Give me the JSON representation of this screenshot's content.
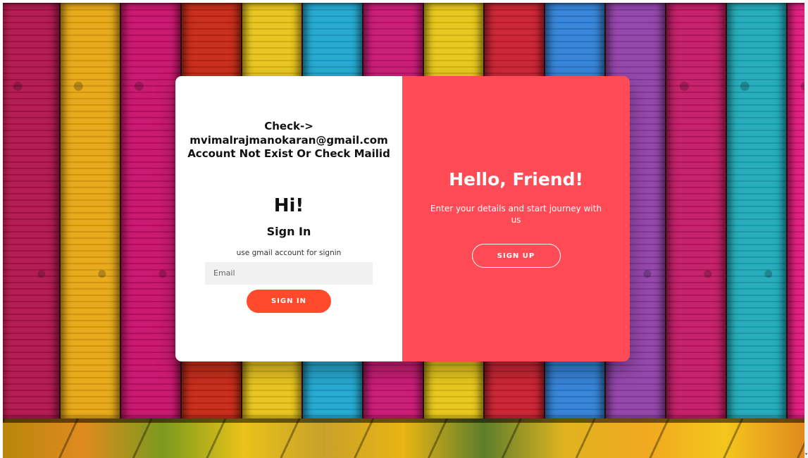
{
  "signin": {
    "error_message": "Check-> mvimalrajmanokaran@gmail.com Account Not Exist Or Check Mailid",
    "greeting": "Hi!",
    "title": "Sign In",
    "hint": "use gmail account for signin",
    "email_placeholder": "Email",
    "email_value": "",
    "button_label": "SIGN IN"
  },
  "overlay": {
    "title": "Hello, Friend!",
    "text": "Enter your details and start journey with us",
    "button_label": "SIGN UP"
  },
  "colors": {
    "signin_button": "#ff4b2b",
    "overlay_background": "#ff4b55",
    "input_background": "#f1f1f1"
  },
  "background": {
    "plank_colors": [
      "#b0124a",
      "#e7a712",
      "#c70f6a",
      "#c62612",
      "#e8c317",
      "#1ea7cf",
      "#c81471",
      "#e6c514",
      "#c91e2d",
      "#2f7fd6",
      "#8f3fa8",
      "#c21764",
      "#1ea9b8",
      "#e2177c",
      "#d6861b",
      "#b41f5a"
    ]
  }
}
